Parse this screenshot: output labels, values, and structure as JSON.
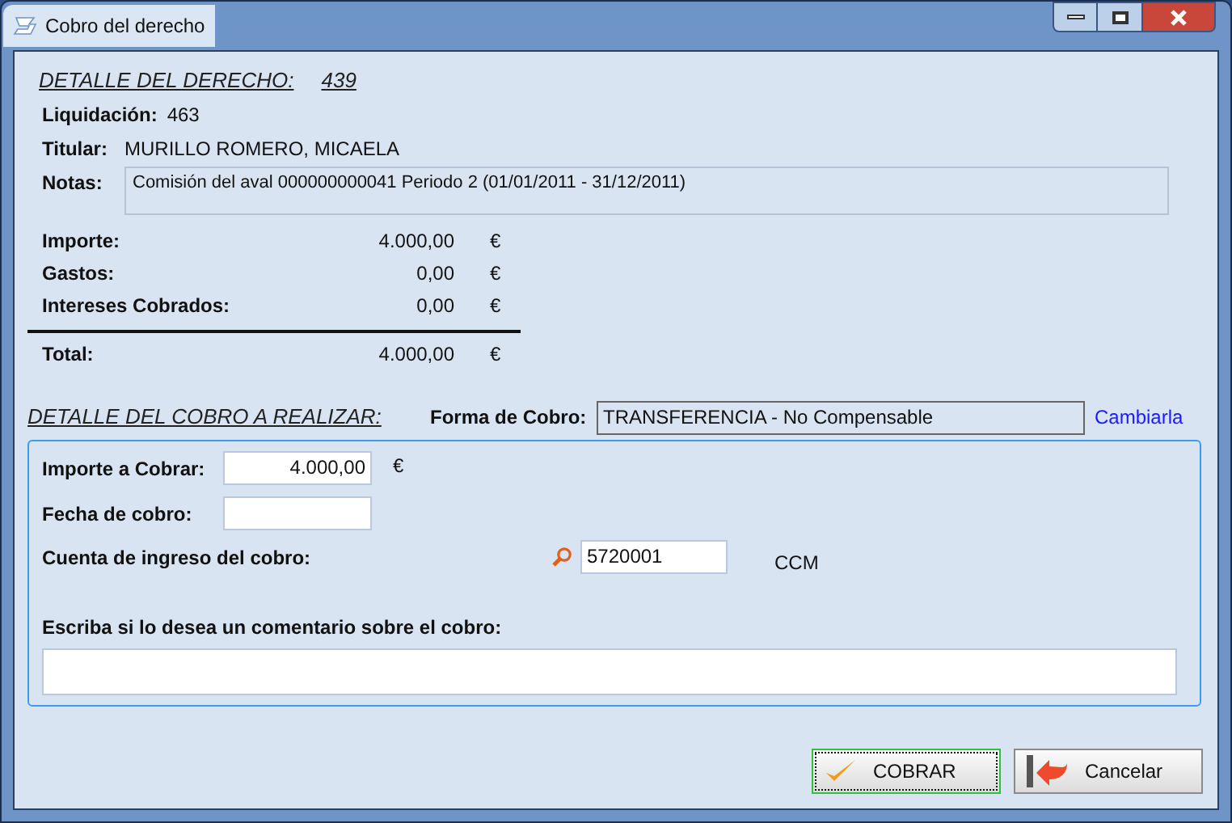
{
  "window": {
    "title": "Cobro del derecho"
  },
  "derecho": {
    "heading": "DETALLE DEL DERECHO:",
    "number": "439",
    "fields": [
      {
        "label": "Liquidación:",
        "value": "463"
      },
      {
        "label": "Titular:",
        "value": "MURILLO ROMERO, MICAELA"
      }
    ],
    "notes_label": "Notas:",
    "notes": "Comisión del aval 000000000041 Periodo 2 (01/01/2011 - 31/12/2011)",
    "amounts": [
      {
        "label": "Importe:",
        "value": "4.000,00",
        "currency": "€"
      },
      {
        "label": "Gastos:",
        "value": "0,00",
        "currency": "€"
      },
      {
        "label": "Intereses Cobrados:",
        "value": "0,00",
        "currency": "€"
      }
    ],
    "total": {
      "label": "Total:",
      "value": "4.000,00",
      "currency": "€"
    }
  },
  "cobro": {
    "heading": "DETALLE DEL COBRO A REALIZAR:",
    "forma_label": "Forma de Cobro:",
    "forma_value": "TRANSFERENCIA - No Compensable",
    "change_link": "Cambiarla",
    "importe_label": "Importe a Cobrar:",
    "importe_value": "4.000,00",
    "importe_currency": "€",
    "fecha_label": "Fecha de cobro:",
    "cuenta_label": "Cuenta de ingreso del cobro:",
    "cuenta_value": "5720001",
    "cuenta_suffix": "CCM",
    "comment_label": "Escriba si lo desea un comentario sobre el cobro:"
  },
  "buttons": [
    {
      "label": "COBRAR",
      "kind": "accept",
      "focused": true
    },
    {
      "label": "Cancelar",
      "kind": "cancel",
      "focused": false
    }
  ]
}
